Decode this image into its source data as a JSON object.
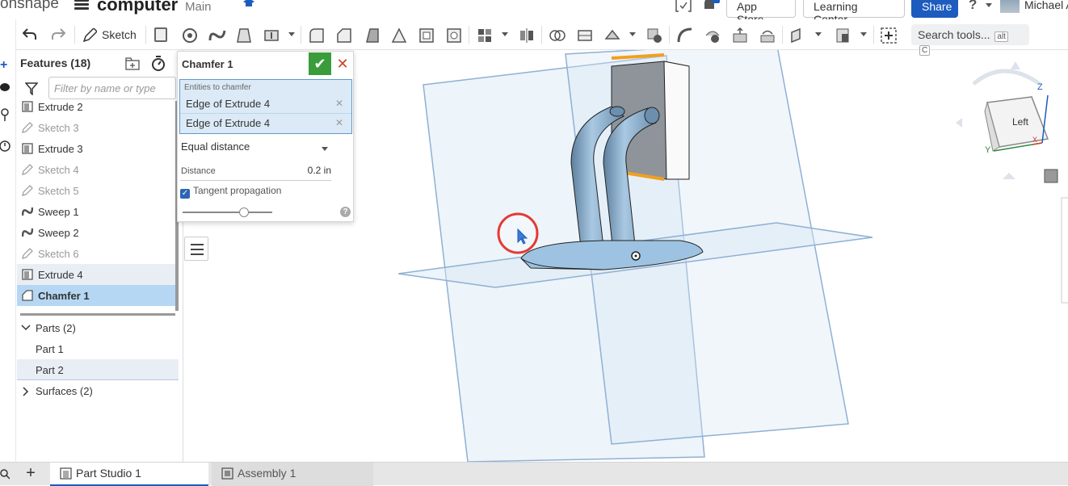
{
  "header": {
    "brand": "onshape",
    "document_name": "computer",
    "workspace": "Main",
    "app_store": "App Store",
    "learning_center": "Learning Center",
    "share": "Share",
    "help": "?",
    "user": "Michael A"
  },
  "toolbar": {
    "sketch_label": "Sketch",
    "search_label": "Search tools...",
    "search_shortcut_1": "alt",
    "search_shortcut_2": "C"
  },
  "features_panel": {
    "title": "Features (18)",
    "filter_placeholder": "Filter by name or type",
    "items": [
      {
        "label": "Extrude 2",
        "type": "extrude",
        "state": "normal"
      },
      {
        "label": "Sketch 3",
        "type": "sketch",
        "state": "dim"
      },
      {
        "label": "Extrude 3",
        "type": "extrude",
        "state": "normal"
      },
      {
        "label": "Sketch 4",
        "type": "sketch",
        "state": "dim"
      },
      {
        "label": "Sketch 5",
        "type": "sketch",
        "state": "dim"
      },
      {
        "label": "Sweep 1",
        "type": "sweep",
        "state": "normal"
      },
      {
        "label": "Sweep 2",
        "type": "sweep",
        "state": "normal"
      },
      {
        "label": "Sketch 6",
        "type": "sketch",
        "state": "dim"
      },
      {
        "label": "Extrude 4",
        "type": "extrude",
        "state": "hover"
      },
      {
        "label": "Chamfer 1",
        "type": "chamfer",
        "state": "selected"
      }
    ],
    "parts_group": "Parts (2)",
    "parts": [
      "Part 1",
      "Part 2"
    ],
    "surfaces_group": "Surfaces (2)"
  },
  "chamfer_dialog": {
    "title": "Chamfer 1",
    "entities_label": "Entities to chamfer",
    "entities": [
      "Edge of Extrude 4",
      "Edge of Extrude 4"
    ],
    "mode": "Equal distance",
    "distance_label": "Distance",
    "distance_value": "0.2 in",
    "tangent_label": "Tangent propagation",
    "tangent_checked": true
  },
  "viewcube": {
    "face_label": "Left",
    "axis_z": "Z",
    "axis_y": "Y",
    "axis_x": "X"
  },
  "bottom_tabs": [
    {
      "label": "Part Studio 1",
      "active": true
    },
    {
      "label": "Assembly 1",
      "active": false
    }
  ],
  "colors": {
    "accent": "#1d5bbf",
    "selection": "#b5d7f3",
    "ok_green": "#3a9c3a",
    "cancel_red": "#d0402a",
    "highlight_edge": "#f0a020"
  }
}
